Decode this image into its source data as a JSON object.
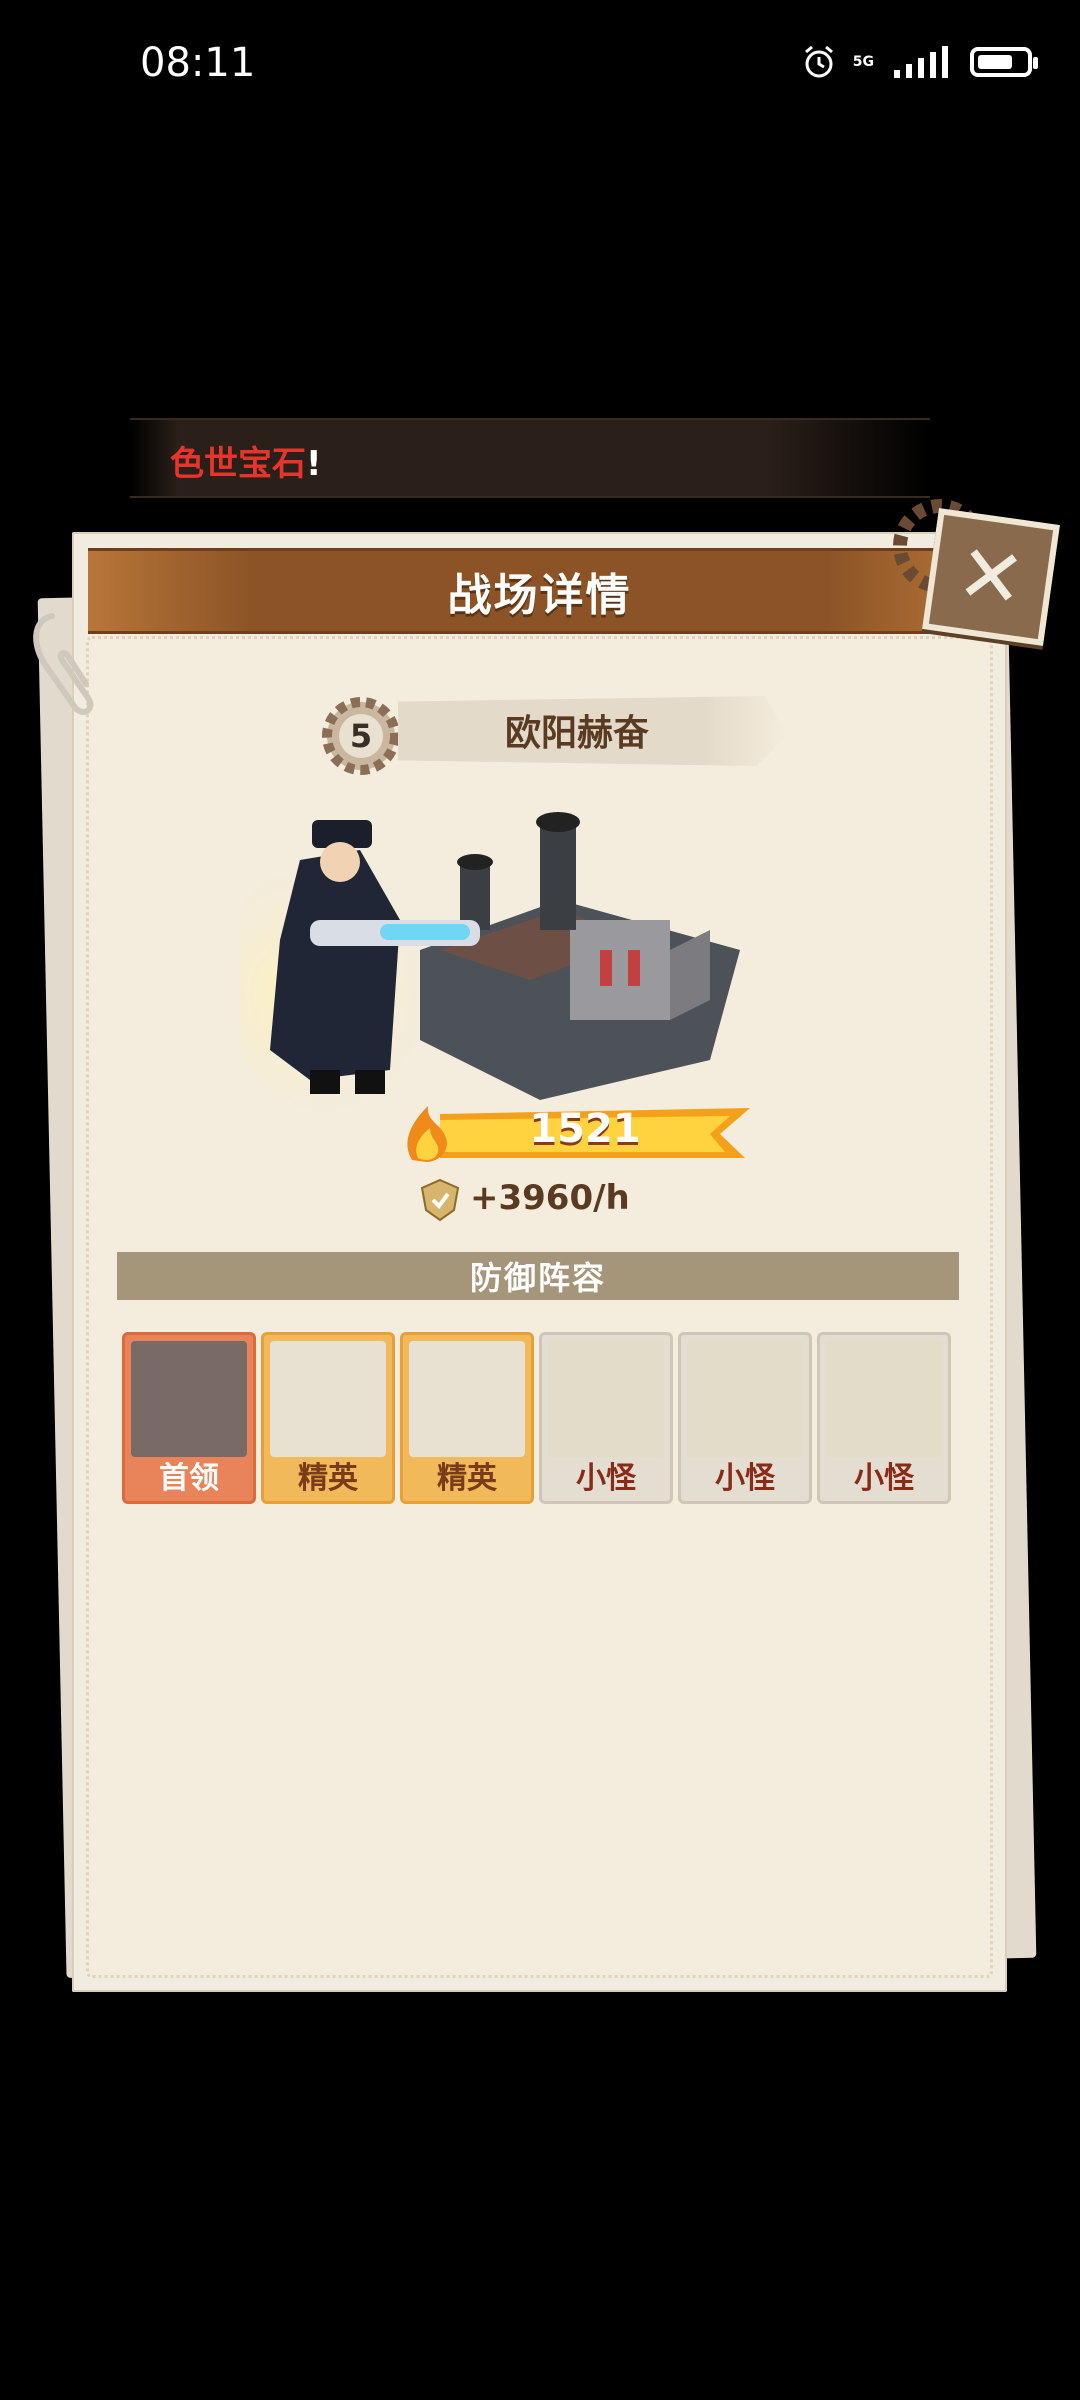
{
  "status_bar": {
    "time": "08:11",
    "network": "5G"
  },
  "marquee": {
    "text": "色世宝石",
    "suffix": "!"
  },
  "dialog": {
    "title": "战场详情",
    "level": "5",
    "player_name": "欧阳赫奋",
    "power": "1521",
    "rate": "+3960/h",
    "section_title": "防御阵容",
    "lineup": [
      {
        "label": "首领",
        "type": "boss"
      },
      {
        "label": "精英",
        "type": "elite"
      },
      {
        "label": "精英",
        "type": "elite"
      },
      {
        "label": "小怪",
        "type": "minion"
      },
      {
        "label": "小怪",
        "type": "minion"
      },
      {
        "label": "小怪",
        "type": "minion"
      }
    ]
  },
  "colors": {
    "title_bar": "#8c5426",
    "panel": "#f2ebdf",
    "boss_card": "#e9835a",
    "elite_card": "#f1b95a",
    "minion_card": "#e4ddd1",
    "marquee_text": "#e8352b"
  },
  "icons": [
    "alarm-icon",
    "signal-icon",
    "battery-icon",
    "paperclip-icon",
    "gear-icon",
    "close-icon",
    "power-flame-icon",
    "coin-shield-icon"
  ]
}
